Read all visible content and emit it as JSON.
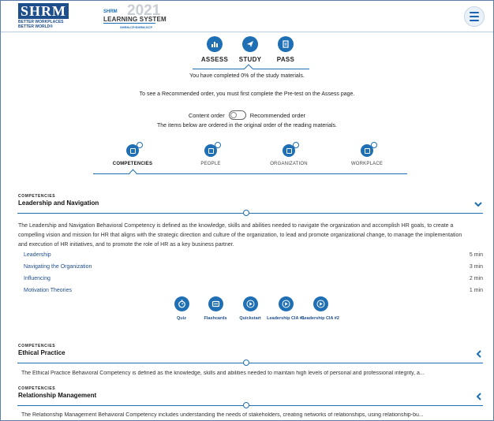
{
  "header": {
    "logo_text": "SHRM",
    "logo_tagline": "BETTER WORKPLACES BETTER WORLD®",
    "ls_brand": "SHRM",
    "ls_year": "2021",
    "ls_title": "LEARNING SYSTEM",
    "ls_sub": "SHRM-CP/SHRM-SCP",
    "menu_icon": "hamburger-menu-icon"
  },
  "top_tabs": [
    {
      "label": "ASSESS",
      "icon": "bar-chart-icon"
    },
    {
      "label": "STUDY",
      "icon": "paper-plane-icon"
    },
    {
      "label": "PASS",
      "icon": "document-icon"
    }
  ],
  "progress_text": "You have completed 0% of the study materials.",
  "pretest_note": "To see a Recommended order, you must first complete the Pre-test on the Assess page.",
  "order_toggle": {
    "left_label": "Content order",
    "right_label": "Recommended order",
    "note": "The items below are ordered in the original order of the reading materials."
  },
  "category_tabs": [
    {
      "label": "COMPETENCIES",
      "active": true
    },
    {
      "label": "PEOPLE",
      "active": false
    },
    {
      "label": "ORGANIZATION",
      "active": false
    },
    {
      "label": "WORKPLACE",
      "active": false
    }
  ],
  "sections": [
    {
      "kicker": "COMPETENCIES",
      "title": "Leadership and Navigation",
      "expanded": true,
      "description": "The Leadership and Navigation Behavioral Competency is defined as the knowledge, skills and abilities needed to navigate the organization and accomplish HR goals, to create a compelling vision and mission for HR that aligns with the strategic direction and culture of the organization, to lead and promote organizational change, to manage the implementation and execution of HR initiatives, and to promote the role of HR as a key business partner.",
      "topics": [
        {
          "name": "Leadership",
          "duration": "5 min"
        },
        {
          "name": "Navigating the Organization",
          "duration": "3 min"
        },
        {
          "name": "Influencing",
          "duration": "2 min"
        },
        {
          "name": "Motivation Theories",
          "duration": "1 min"
        }
      ],
      "actions": [
        {
          "label": "Quiz",
          "icon": "stopwatch-icon"
        },
        {
          "label": "Flashcards",
          "icon": "flashcards-icon"
        },
        {
          "label": "Quickstart",
          "icon": "play-icon"
        },
        {
          "label": "Leadership CIA #1",
          "icon": "play-circle-icon"
        },
        {
          "label": "Leadership CIA #2",
          "icon": "play-circle-icon"
        }
      ]
    },
    {
      "kicker": "COMPETENCIES",
      "title": "Ethical Practice",
      "expanded": false,
      "description": "The Ethical Practice Behavioral Competency is defined as the knowledge, skills and abilities needed to maintain high levels of personal and professional integrity, a..."
    },
    {
      "kicker": "COMPETENCIES",
      "title": "Relationship Management",
      "expanded": false,
      "description": "The Relationship Management Behavioral Competency includes understanding the needs of stakeholders, creating networks of relationships, using relationship-bu..."
    }
  ],
  "colors": {
    "accent": "#1f6fb5",
    "brand": "#1f4e8c"
  }
}
